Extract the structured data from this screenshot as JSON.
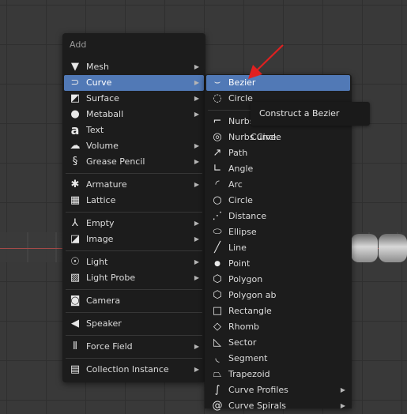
{
  "main_menu": {
    "title": "Add",
    "items": [
      {
        "label": "Mesh",
        "icon": "mesh-icon"
      },
      {
        "label": "Curve",
        "icon": "curve-icon"
      },
      {
        "label": "Surface",
        "icon": "surface-icon"
      },
      {
        "label": "Metaball",
        "icon": "metaball-icon"
      },
      {
        "label": "Text",
        "icon": "text-icon"
      },
      {
        "label": "Volume",
        "icon": "volume-icon"
      },
      {
        "label": "Grease Pencil",
        "icon": "grease-pencil-icon"
      },
      {
        "label": "Armature",
        "icon": "armature-icon"
      },
      {
        "label": "Lattice",
        "icon": "lattice-icon"
      },
      {
        "label": "Empty",
        "icon": "empty-icon"
      },
      {
        "label": "Image",
        "icon": "image-icon"
      },
      {
        "label": "Light",
        "icon": "light-icon"
      },
      {
        "label": "Light Probe",
        "icon": "light-probe-icon"
      },
      {
        "label": "Camera",
        "icon": "camera-icon"
      },
      {
        "label": "Speaker",
        "icon": "speaker-icon"
      },
      {
        "label": "Force Field",
        "icon": "force-field-icon"
      },
      {
        "label": "Collection Instance",
        "icon": "collection-instance-icon"
      }
    ]
  },
  "curve_submenu": {
    "items": [
      {
        "label": "Bezier",
        "icon": "bezier-icon"
      },
      {
        "label": "Circle",
        "icon": "circle-icon"
      },
      {
        "label": "Nurbs Curve",
        "icon": "nurbs-curve-icon"
      },
      {
        "label": "Nurbs Circle",
        "icon": "nurbs-circle-icon"
      },
      {
        "label": "Path",
        "icon": "path-icon"
      },
      {
        "label": "Angle",
        "icon": "angle-icon"
      },
      {
        "label": "Arc",
        "icon": "arc-icon"
      },
      {
        "label": "Circle",
        "icon": "circle-icon"
      },
      {
        "label": "Distance",
        "icon": "distance-icon"
      },
      {
        "label": "Ellipse",
        "icon": "ellipse-icon"
      },
      {
        "label": "Line",
        "icon": "line-icon"
      },
      {
        "label": "Point",
        "icon": "point-icon"
      },
      {
        "label": "Polygon",
        "icon": "polygon-icon"
      },
      {
        "label": "Polygon ab",
        "icon": "polygon-ab-icon"
      },
      {
        "label": "Rectangle",
        "icon": "rectangle-icon"
      },
      {
        "label": "Rhomb",
        "icon": "rhomb-icon"
      },
      {
        "label": "Sector",
        "icon": "sector-icon"
      },
      {
        "label": "Segment",
        "icon": "segment-icon"
      },
      {
        "label": "Trapezoid",
        "icon": "trapezoid-icon"
      },
      {
        "label": "Curve Profiles",
        "icon": "curve-profiles-icon"
      },
      {
        "label": "Curve Spirals",
        "icon": "curve-spirals-icon"
      }
    ]
  },
  "tooltip": {
    "text": "Construct a Bezier Curve."
  },
  "colors": {
    "highlight": "#5179b6",
    "menu_bg": "#1c1c1c",
    "pointer_arrow": "#e02020",
    "viewport_bg": "#393939"
  }
}
